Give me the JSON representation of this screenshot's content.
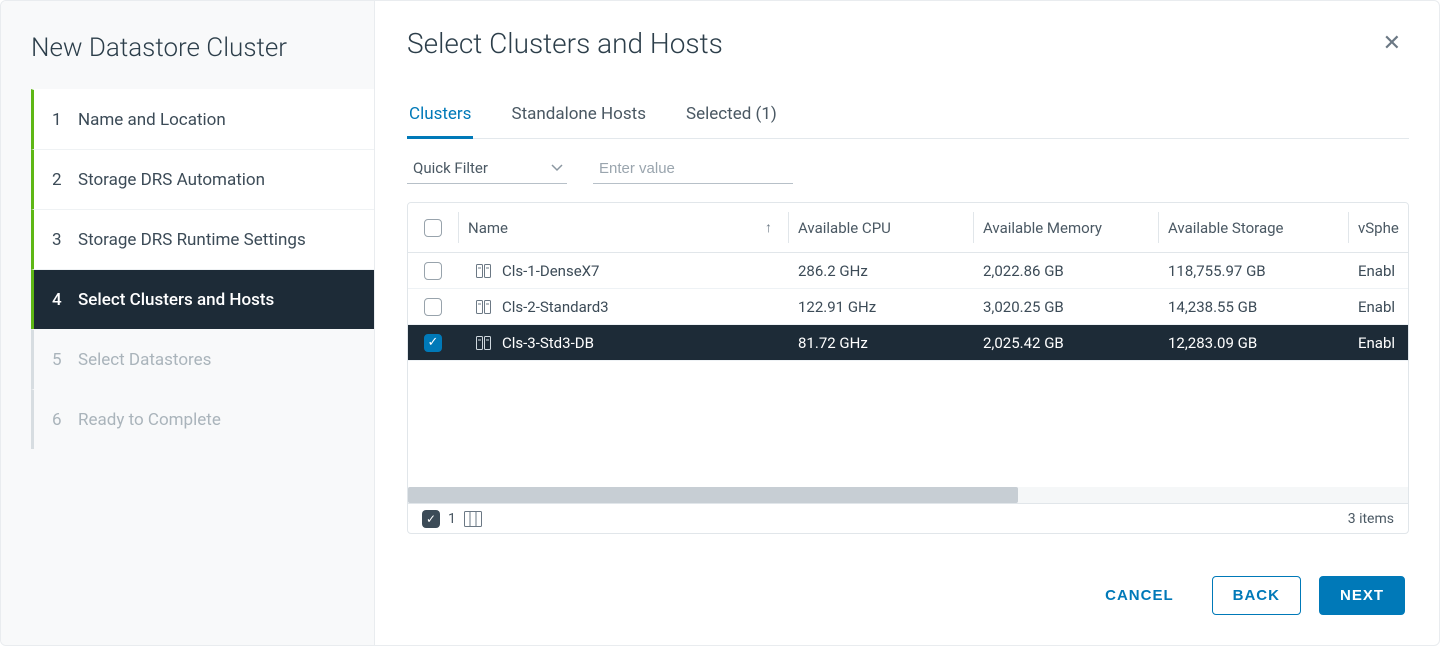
{
  "sidebar": {
    "title": "New Datastore Cluster",
    "steps": [
      {
        "num": "1",
        "label": "Name and Location",
        "state": "completed"
      },
      {
        "num": "2",
        "label": "Storage DRS Automation",
        "state": "completed"
      },
      {
        "num": "3",
        "label": "Storage DRS Runtime Settings",
        "state": "completed"
      },
      {
        "num": "4",
        "label": "Select Clusters and Hosts",
        "state": "active"
      },
      {
        "num": "5",
        "label": "Select Datastores",
        "state": "future"
      },
      {
        "num": "6",
        "label": "Ready to Complete",
        "state": "future"
      }
    ]
  },
  "header": {
    "title": "Select Clusters and Hosts"
  },
  "tabs": {
    "clusters": "Clusters",
    "standalone": "Standalone Hosts",
    "selected": "Selected (1)"
  },
  "filter": {
    "quick_label": "Quick Filter",
    "input_placeholder": "Enter value"
  },
  "table": {
    "headers": {
      "name": "Name",
      "cpu": "Available CPU",
      "memory": "Available Memory",
      "storage": "Available Storage",
      "ha": "vSphe"
    },
    "rows": [
      {
        "name": "Cls-1-DenseX7",
        "cpu": "286.2 GHz",
        "memory": "2,022.86 GB",
        "storage": "118,755.97 GB",
        "ha": "Enabl",
        "checked": false
      },
      {
        "name": "Cls-2-Standard3",
        "cpu": "122.91 GHz",
        "memory": "3,020.25 GB",
        "storage": "14,238.55 GB",
        "ha": "Enabl",
        "checked": false
      },
      {
        "name": "Cls-3-Std3-DB",
        "cpu": "81.72 GHz",
        "memory": "2,025.42 GB",
        "storage": "12,283.09 GB",
        "ha": "Enabl",
        "checked": true
      }
    ],
    "footer": {
      "selected_count": "1",
      "items_text": "3 items"
    }
  },
  "footer": {
    "cancel": "CANCEL",
    "back": "BACK",
    "next": "NEXT"
  }
}
